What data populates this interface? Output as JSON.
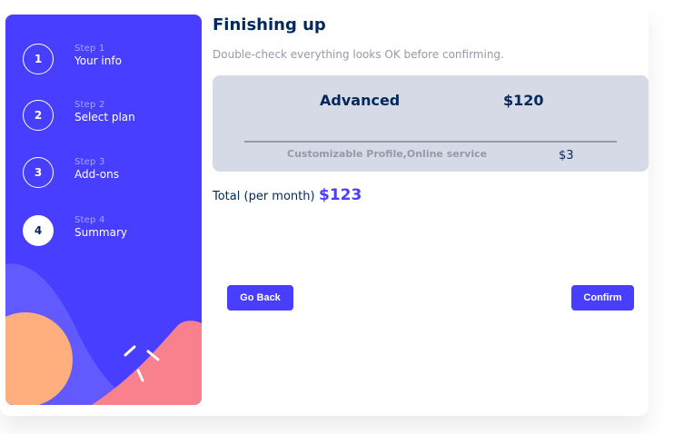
{
  "steps": [
    {
      "number": "1",
      "sub": "Step 1",
      "title": "Your info",
      "active": false
    },
    {
      "number": "2",
      "sub": "Step 2",
      "title": "Select plan",
      "active": false
    },
    {
      "number": "3",
      "sub": "Step 3",
      "title": "Add-ons",
      "active": false
    },
    {
      "number": "4",
      "sub": "Step 4",
      "title": "Summary",
      "active": true
    }
  ],
  "page": {
    "title": "Finishing up",
    "subtitle": "Double-check everything looks OK before confirming."
  },
  "summary": {
    "plan_name": "Advanced",
    "plan_price": "$120",
    "addon_name": "Customizable Profile,Online service",
    "addon_price": "$3"
  },
  "total": {
    "label": "Total (per month)",
    "value": "$123"
  },
  "buttons": {
    "back": "Go Back",
    "confirm": "Confirm"
  },
  "colors": {
    "accent": "#483eff",
    "marine": "#02295a",
    "cool_gray": "#9699ab",
    "light_gray": "#d6d9e6",
    "orange": "#ffaf7e",
    "pink": "#f9818e",
    "periwinkle": "#6259ff"
  }
}
